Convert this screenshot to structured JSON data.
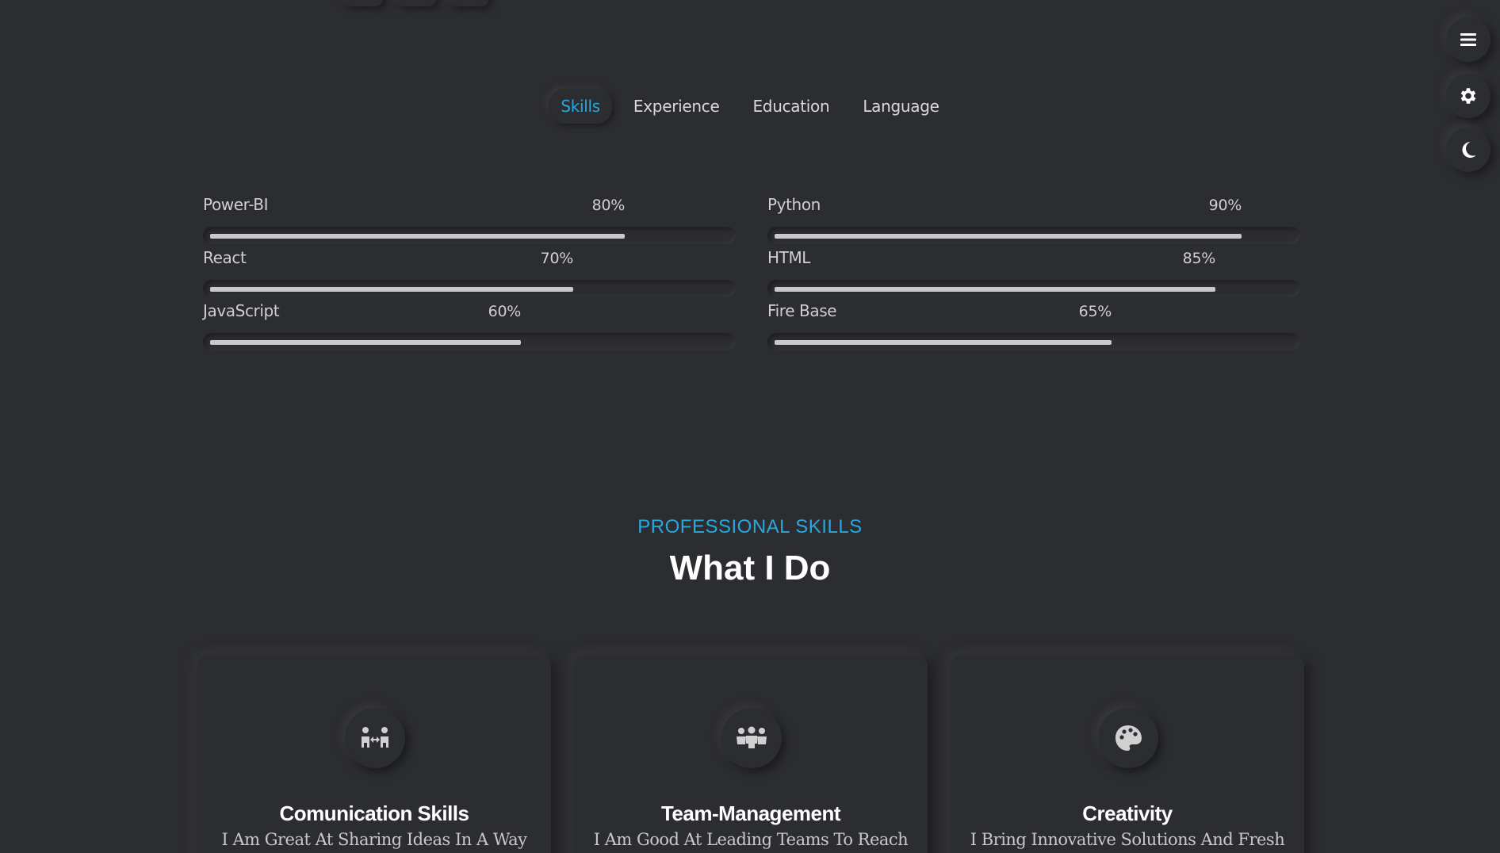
{
  "side_controls": [
    {
      "icon": "menu-icon"
    },
    {
      "icon": "gear-icon"
    },
    {
      "icon": "moon-icon"
    }
  ],
  "tabs": [
    {
      "label": "Skills",
      "active": true
    },
    {
      "label": "Experience",
      "active": false
    },
    {
      "label": "Education",
      "active": false
    },
    {
      "label": "Language",
      "active": false
    }
  ],
  "skills": [
    {
      "name": "Power-BI",
      "percent_label": "80%",
      "percent": 80
    },
    {
      "name": "Python",
      "percent_label": "90%",
      "percent": 90
    },
    {
      "name": "React",
      "percent_label": "70%",
      "percent": 70
    },
    {
      "name": "HTML",
      "percent_label": "85%",
      "percent": 85
    },
    {
      "name": "JavaScript",
      "percent_label": "60%",
      "percent": 60
    },
    {
      "name": "Fire Base",
      "percent_label": "65%",
      "percent": 65
    }
  ],
  "section": {
    "eyebrow": "PROFESSIONAL SKILLS",
    "title": "What I Do"
  },
  "cards": [
    {
      "icon": "people-arrows-icon",
      "title": "Comunication Skills",
      "description": "I Am Great At Sharing Ideas In A Way"
    },
    {
      "icon": "people-group-icon",
      "title": "Team-Management",
      "description": "I Am Good At Leading Teams To Reach"
    },
    {
      "icon": "palette-icon",
      "title": "Creativity",
      "description": "I Bring Innovative Solutions And Fresh"
    }
  ],
  "colors": {
    "background": "#2c2d31",
    "accent": "#2aa8de",
    "bar_fill": "#c9c9c9",
    "heading": "#ffffff"
  }
}
